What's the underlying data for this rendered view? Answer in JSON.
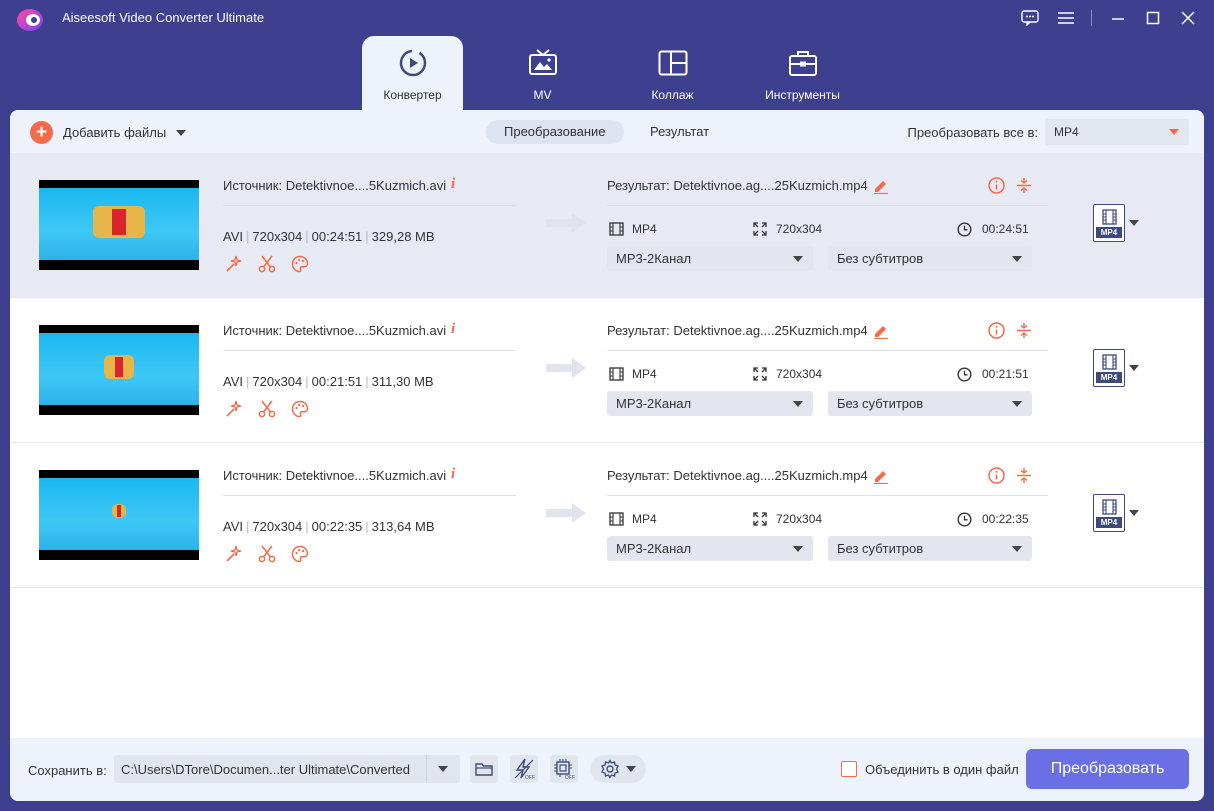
{
  "app": {
    "title": "Aiseesoft Video Converter Ultimate"
  },
  "main_tabs": [
    {
      "label": "Конвертер",
      "icon": "converter-icon",
      "active": true
    },
    {
      "label": "MV",
      "icon": "tv-icon",
      "active": false
    },
    {
      "label": "Коллаж",
      "icon": "collage-icon",
      "active": false
    },
    {
      "label": "Инструменты",
      "icon": "toolbox-icon",
      "active": false
    }
  ],
  "toolbar": {
    "add_files_label": "Добавить файлы",
    "tabs": [
      {
        "label": "Преобразование",
        "active": true
      },
      {
        "label": "Результат",
        "active": false
      }
    ],
    "convert_all_label": "Преобразовать все в:",
    "convert_all_value": "MP4"
  },
  "files": [
    {
      "source": "Источник: Detektivnoe....5Kuzmich.avi",
      "format": "AVI",
      "resolution": "720x304",
      "duration": "00:24:51",
      "size": "329,28 MB",
      "result": "Результат: Detektivnoe.ag....25Kuzmich.mp4",
      "out_format": "MP4",
      "out_resolution": "720x304",
      "out_duration": "00:24:51",
      "audio": "MP3-2Канал",
      "subtitles": "Без субтитров",
      "format_badge": "MP4",
      "selected": true
    },
    {
      "source": "Источник: Detektivnoe....5Kuzmich.avi",
      "format": "AVI",
      "resolution": "720x304",
      "duration": "00:21:51",
      "size": "311,30 MB",
      "result": "Результат: Detektivnoe.ag....25Kuzmich.mp4",
      "out_format": "MP4",
      "out_resolution": "720x304",
      "out_duration": "00:21:51",
      "audio": "MP3-2Канал",
      "subtitles": "Без субтитров",
      "format_badge": "MP4",
      "selected": false
    },
    {
      "source": "Источник: Detektivnoe....5Kuzmich.avi",
      "format": "AVI",
      "resolution": "720x304",
      "duration": "00:22:35",
      "size": "313,64 MB",
      "result": "Результат: Detektivnoe.ag....25Kuzmich.mp4",
      "out_format": "MP4",
      "out_resolution": "720x304",
      "out_duration": "00:22:35",
      "audio": "MP3-2Канал",
      "subtitles": "Без субтитров",
      "format_badge": "MP4",
      "selected": false
    }
  ],
  "bottom": {
    "save_label": "Сохранить в:",
    "path": "C:\\Users\\DTore\\Documen...ter Ultimate\\Converted",
    "merge_label": "Объединить в один файл",
    "convert_label": "Преобразовать"
  },
  "colors": {
    "accent": "#f36b4a",
    "primary": "#6a6fe6",
    "frame": "#3f3f8f"
  }
}
